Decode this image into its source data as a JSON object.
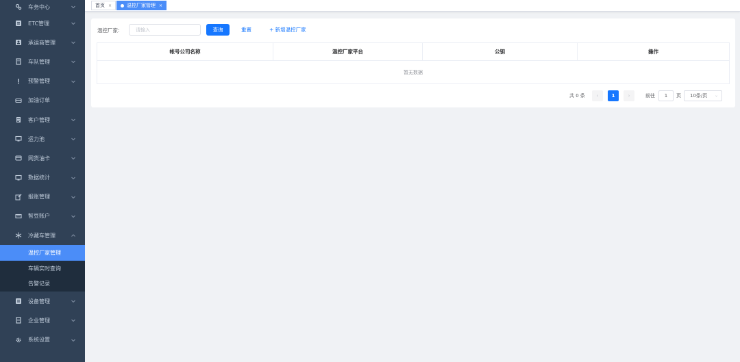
{
  "sidebar": {
    "items": [
      {
        "label": "车务中心",
        "icon": "cogs-icon",
        "chevron": "down"
      },
      {
        "label": "ETC管理",
        "icon": "id-card-icon",
        "chevron": "down"
      },
      {
        "label": "承运商管理",
        "icon": "user-card-icon",
        "chevron": "down"
      },
      {
        "label": "车队管理",
        "icon": "building-icon",
        "chevron": "down"
      },
      {
        "label": "预警管理",
        "icon": "exclamation-icon",
        "chevron": "down"
      },
      {
        "label": "加油订单",
        "icon": "card-icon",
        "chevron": ""
      },
      {
        "label": "客户管理",
        "icon": "document-icon",
        "chevron": "down"
      },
      {
        "label": "运力池",
        "icon": "monitor-icon",
        "chevron": "down"
      },
      {
        "label": "网货油卡",
        "icon": "credit-card-icon",
        "chevron": "down"
      },
      {
        "label": "数据统计",
        "icon": "monitor-icon",
        "chevron": "down"
      },
      {
        "label": "报账管理",
        "icon": "edit-icon",
        "chevron": "down"
      },
      {
        "label": "智豆账户",
        "icon": "keyboard-icon",
        "chevron": "down"
      },
      {
        "label": "冷藏车管理",
        "icon": "snowflake-icon",
        "chevron": "up"
      }
    ],
    "sub_items": [
      {
        "label": "温控厂家管理",
        "active": true
      },
      {
        "label": "车辆实时查询",
        "active": false
      },
      {
        "label": "告警记录",
        "active": false
      }
    ],
    "items_after": [
      {
        "label": "设备管理",
        "icon": "id-card-icon",
        "chevron": "down"
      },
      {
        "label": "企业管理",
        "icon": "building-icon",
        "chevron": "down"
      },
      {
        "label": "系统设置",
        "icon": "gear-icon",
        "chevron": "down"
      }
    ]
  },
  "tabs": [
    {
      "label": "首页",
      "active": false
    },
    {
      "label": "温控厂家管理",
      "active": true
    }
  ],
  "filter": {
    "label": "温控厂家:",
    "placeholder": "请输入",
    "search_label": "查询",
    "reset_label": "重置",
    "add_label": "+ 新增温控厂家"
  },
  "table": {
    "columns": [
      "帐号公司名称",
      "温控厂家平台",
      "公钥",
      "操作"
    ],
    "empty_text": "暂无数据"
  },
  "pagination": {
    "total_text": "共 0 条",
    "current_page": "1",
    "goto_label": "前往",
    "goto_value": "1",
    "page_suffix": "页",
    "page_size": "10条/页"
  },
  "colors": {
    "sidebar_bg": "#304156",
    "active_menu": "#4b8df8",
    "primary": "#1677ff"
  }
}
